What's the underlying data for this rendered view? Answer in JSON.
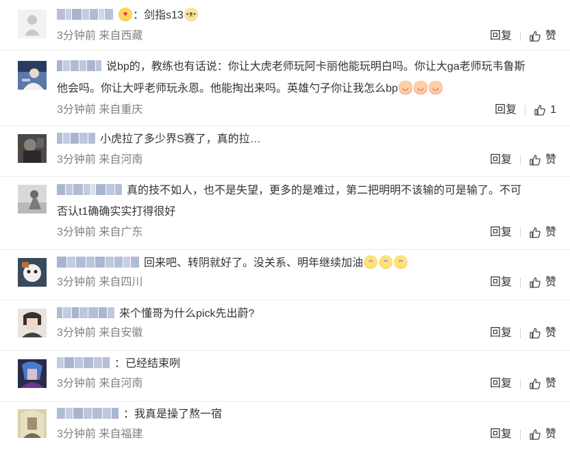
{
  "comments": [
    {
      "username": "",
      "text": "：剑指s13",
      "prefix_emoji": "emoji-heart",
      "suffix_emojis": [
        "emoji-doge"
      ],
      "time": "3分钟前",
      "location": "来自西藏",
      "reply_label": "回复",
      "like_label": "赞"
    },
    {
      "username": "",
      "text_line1": "说bp的，教练也有话说：你让大虎老师玩阿卡丽他能玩明白吗。你让大ga老师玩韦鲁斯",
      "text_line2": "他会吗。你让大呼老师玩永恩。他能掏出来吗。英雄勺子你让我怎么bp",
      "suffix_emojis": [
        "emoji-baby",
        "emoji-baby",
        "emoji-baby"
      ],
      "time": "3分钟前",
      "location": "来自重庆",
      "reply_label": "回复",
      "like_label": "1"
    },
    {
      "username": "",
      "text": "小虎拉了多少界S赛了，真的拉…",
      "time": "3分钟前",
      "location": "来自河南",
      "reply_label": "回复",
      "like_label": "赞"
    },
    {
      "username": "",
      "text_line1": "真的技不如人，也不是失望，更多的是难过，第二把明明不该输的可是输了。不可",
      "text_line2": "否认t1确确实实打得很好",
      "time": "3分钟前",
      "location": "来自广东",
      "reply_label": "回复",
      "like_label": "赞"
    },
    {
      "username": "",
      "text": "回来吧、转阴就好了。没关系、明年继续加油",
      "suffix_emojis": [
        "emoji-cry",
        "emoji-cry",
        "emoji-cry"
      ],
      "time": "3分钟前",
      "location": "来自四川",
      "reply_label": "回复",
      "like_label": "赞"
    },
    {
      "username": "",
      "text": "来个懂哥为什么pick先出蔚?",
      "time": "3分钟前",
      "location": "来自安徽",
      "reply_label": "回复",
      "like_label": "赞"
    },
    {
      "username": "",
      "text": "：已经结束咧",
      "time": "3分钟前",
      "location": "来自河南",
      "reply_label": "回复",
      "like_label": "赞"
    },
    {
      "username": "",
      "text": "：我真是操了熬一宿",
      "time": "3分钟前",
      "location": "来自福建",
      "reply_label": "回复",
      "like_label": "赞"
    }
  ],
  "icons": {
    "like": "thumbs-up-icon"
  },
  "colors": {
    "username_blur": "#b8c4dc",
    "meta_text": "#808080",
    "body_text": "#333333"
  }
}
